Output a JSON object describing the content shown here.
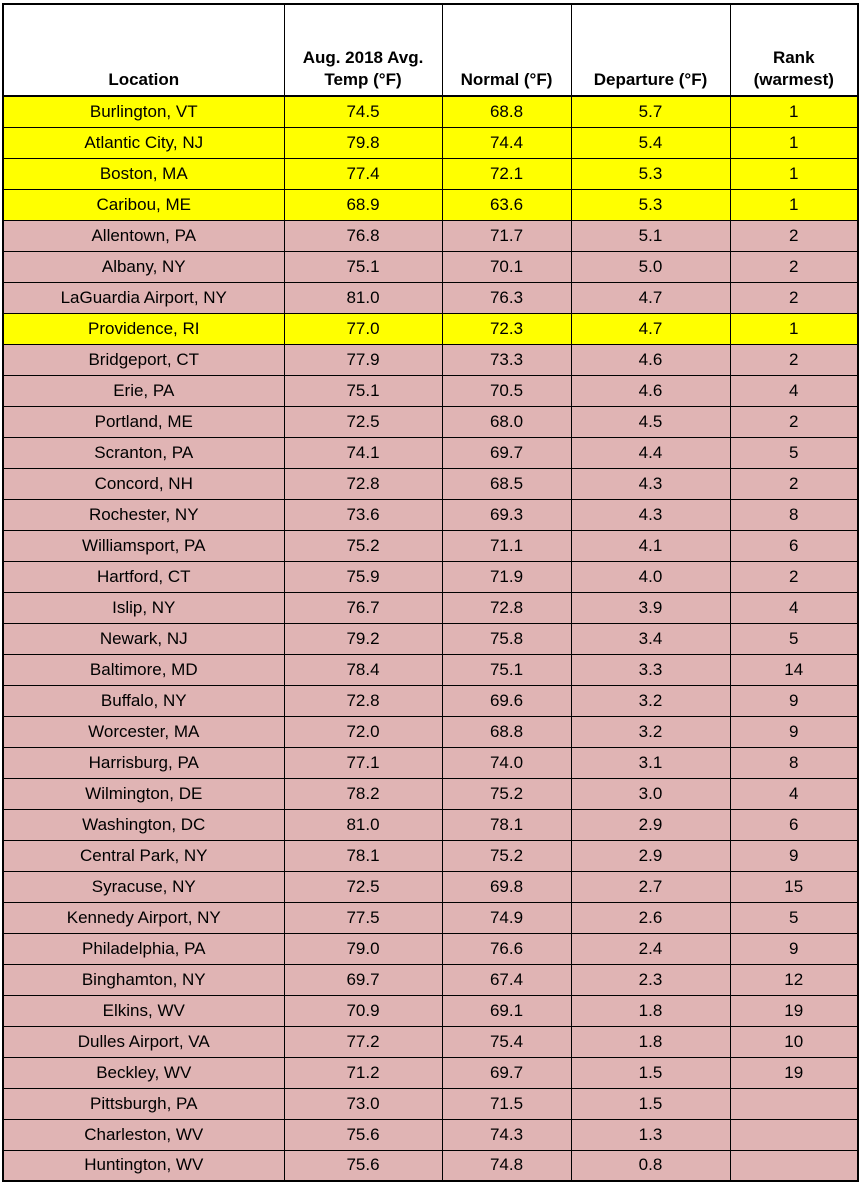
{
  "table": {
    "columns": [
      {
        "key": "location",
        "label": "Location"
      },
      {
        "key": "avg_temp",
        "label": "Aug. 2018 Avg. Temp (°F)"
      },
      {
        "key": "normal",
        "label": "Normal (°F)"
      },
      {
        "key": "departure",
        "label": "Departure (°F)"
      },
      {
        "key": "rank",
        "label": "Rank (warmest)"
      }
    ],
    "header_lines": {
      "location": [
        "Location"
      ],
      "avg_temp": [
        "Aug. 2018 Avg.",
        "Temp (°F)"
      ],
      "normal": [
        "Normal (°F)"
      ],
      "departure": [
        "Departure (°F)"
      ],
      "rank": [
        "Rank",
        "(warmest)"
      ]
    },
    "colors": {
      "highlight_record": "#ffff00",
      "row_background": "#e0b4b4",
      "header_background": "#ffffff",
      "grid_line": "#000000",
      "text": "#000000"
    },
    "rows": [
      {
        "location": "Burlington, VT",
        "avg_temp": "74.5",
        "normal": "68.8",
        "departure": "5.7",
        "rank": "1",
        "highlight": "yellow"
      },
      {
        "location": "Atlantic City, NJ",
        "avg_temp": "79.8",
        "normal": "74.4",
        "departure": "5.4",
        "rank": "1",
        "highlight": "yellow"
      },
      {
        "location": "Boston, MA",
        "avg_temp": "77.4",
        "normal": "72.1",
        "departure": "5.3",
        "rank": "1",
        "highlight": "yellow"
      },
      {
        "location": "Caribou, ME",
        "avg_temp": "68.9",
        "normal": "63.6",
        "departure": "5.3",
        "rank": "1",
        "highlight": "yellow"
      },
      {
        "location": "Allentown, PA",
        "avg_temp": "76.8",
        "normal": "71.7",
        "departure": "5.1",
        "rank": "2",
        "highlight": "pink"
      },
      {
        "location": "Albany, NY",
        "avg_temp": "75.1",
        "normal": "70.1",
        "departure": "5.0",
        "rank": "2",
        "highlight": "pink"
      },
      {
        "location": "LaGuardia Airport, NY",
        "avg_temp": "81.0",
        "normal": "76.3",
        "departure": "4.7",
        "rank": "2",
        "highlight": "pink"
      },
      {
        "location": "Providence, RI",
        "avg_temp": "77.0",
        "normal": "72.3",
        "departure": "4.7",
        "rank": "1",
        "highlight": "yellow"
      },
      {
        "location": "Bridgeport, CT",
        "avg_temp": "77.9",
        "normal": "73.3",
        "departure": "4.6",
        "rank": "2",
        "highlight": "pink"
      },
      {
        "location": "Erie, PA",
        "avg_temp": "75.1",
        "normal": "70.5",
        "departure": "4.6",
        "rank": "4",
        "highlight": "pink"
      },
      {
        "location": "Portland, ME",
        "avg_temp": "72.5",
        "normal": "68.0",
        "departure": "4.5",
        "rank": "2",
        "highlight": "pink"
      },
      {
        "location": "Scranton, PA",
        "avg_temp": "74.1",
        "normal": "69.7",
        "departure": "4.4",
        "rank": "5",
        "highlight": "pink"
      },
      {
        "location": "Concord, NH",
        "avg_temp": "72.8",
        "normal": "68.5",
        "departure": "4.3",
        "rank": "2",
        "highlight": "pink"
      },
      {
        "location": "Rochester, NY",
        "avg_temp": "73.6",
        "normal": "69.3",
        "departure": "4.3",
        "rank": "8",
        "highlight": "pink"
      },
      {
        "location": "Williamsport, PA",
        "avg_temp": "75.2",
        "normal": "71.1",
        "departure": "4.1",
        "rank": "6",
        "highlight": "pink"
      },
      {
        "location": "Hartford, CT",
        "avg_temp": "75.9",
        "normal": "71.9",
        "departure": "4.0",
        "rank": "2",
        "highlight": "pink"
      },
      {
        "location": "Islip, NY",
        "avg_temp": "76.7",
        "normal": "72.8",
        "departure": "3.9",
        "rank": "4",
        "highlight": "pink"
      },
      {
        "location": "Newark, NJ",
        "avg_temp": "79.2",
        "normal": "75.8",
        "departure": "3.4",
        "rank": "5",
        "highlight": "pink"
      },
      {
        "location": "Baltimore, MD",
        "avg_temp": "78.4",
        "normal": "75.1",
        "departure": "3.3",
        "rank": "14",
        "highlight": "pink"
      },
      {
        "location": "Buffalo, NY",
        "avg_temp": "72.8",
        "normal": "69.6",
        "departure": "3.2",
        "rank": "9",
        "highlight": "pink"
      },
      {
        "location": "Worcester, MA",
        "avg_temp": "72.0",
        "normal": "68.8",
        "departure": "3.2",
        "rank": "9",
        "highlight": "pink"
      },
      {
        "location": "Harrisburg, PA",
        "avg_temp": "77.1",
        "normal": "74.0",
        "departure": "3.1",
        "rank": "8",
        "highlight": "pink"
      },
      {
        "location": "Wilmington, DE",
        "avg_temp": "78.2",
        "normal": "75.2",
        "departure": "3.0",
        "rank": "4",
        "highlight": "pink"
      },
      {
        "location": "Washington, DC",
        "avg_temp": "81.0",
        "normal": "78.1",
        "departure": "2.9",
        "rank": "6",
        "highlight": "pink"
      },
      {
        "location": "Central Park, NY",
        "avg_temp": "78.1",
        "normal": "75.2",
        "departure": "2.9",
        "rank": "9",
        "highlight": "pink"
      },
      {
        "location": "Syracuse, NY",
        "avg_temp": "72.5",
        "normal": "69.8",
        "departure": "2.7",
        "rank": "15",
        "highlight": "pink"
      },
      {
        "location": "Kennedy Airport, NY",
        "avg_temp": "77.5",
        "normal": "74.9",
        "departure": "2.6",
        "rank": "5",
        "highlight": "pink"
      },
      {
        "location": "Philadelphia, PA",
        "avg_temp": "79.0",
        "normal": "76.6",
        "departure": "2.4",
        "rank": "9",
        "highlight": "pink"
      },
      {
        "location": "Binghamton, NY",
        "avg_temp": "69.7",
        "normal": "67.4",
        "departure": "2.3",
        "rank": "12",
        "highlight": "pink"
      },
      {
        "location": "Elkins, WV",
        "avg_temp": "70.9",
        "normal": "69.1",
        "departure": "1.8",
        "rank": "19",
        "highlight": "pink"
      },
      {
        "location": "Dulles Airport, VA",
        "avg_temp": "77.2",
        "normal": "75.4",
        "departure": "1.8",
        "rank": "10",
        "highlight": "pink"
      },
      {
        "location": "Beckley, WV",
        "avg_temp": "71.2",
        "normal": "69.7",
        "departure": "1.5",
        "rank": "19",
        "highlight": "pink"
      },
      {
        "location": "Pittsburgh, PA",
        "avg_temp": "73.0",
        "normal": "71.5",
        "departure": "1.5",
        "rank": "",
        "highlight": "pink"
      },
      {
        "location": "Charleston, WV",
        "avg_temp": "75.6",
        "normal": "74.3",
        "departure": "1.3",
        "rank": "",
        "highlight": "pink"
      },
      {
        "location": "Huntington, WV",
        "avg_temp": "75.6",
        "normal": "74.8",
        "departure": "0.8",
        "rank": "",
        "highlight": "pink"
      }
    ]
  }
}
